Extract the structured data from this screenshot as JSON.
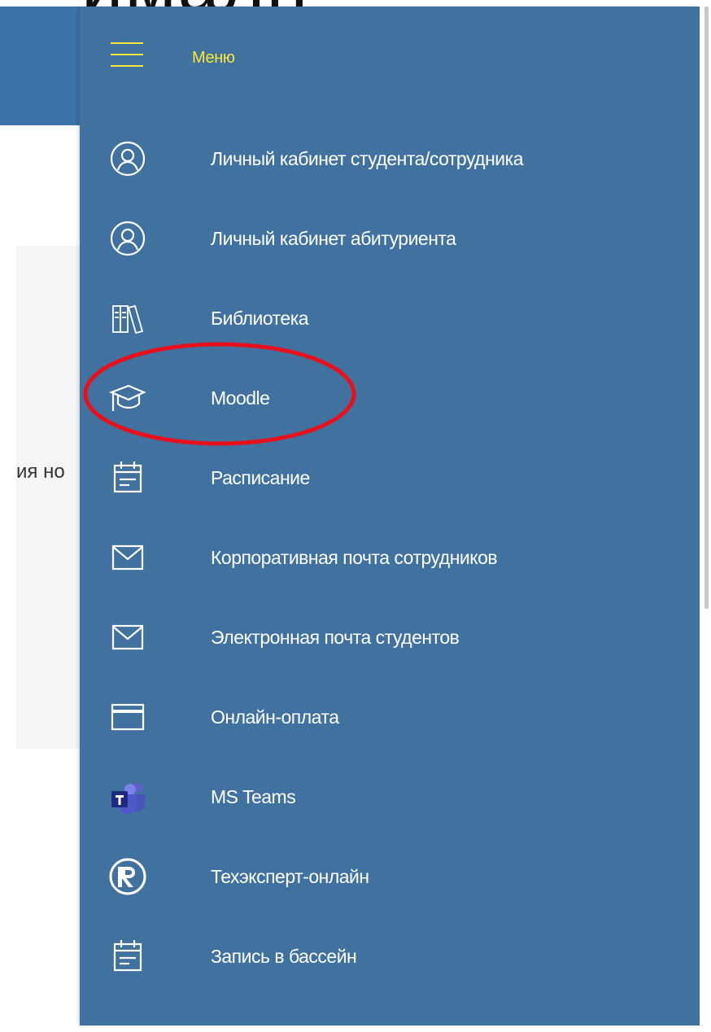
{
  "background": {
    "partial_heading": "ималн",
    "partial_text": "ия но"
  },
  "menu": {
    "title": "Меню",
    "items": [
      {
        "label": "Личный кабинет студента/сотрудника",
        "icon": "user-circle-icon"
      },
      {
        "label": "Личный кабинет абитуриента",
        "icon": "user-circle-icon"
      },
      {
        "label": "Библиотека",
        "icon": "books-icon"
      },
      {
        "label": "Moodle",
        "icon": "graduation-cap-icon"
      },
      {
        "label": "Расписание",
        "icon": "calendar-icon"
      },
      {
        "label": "Корпоративная почта сотрудников",
        "icon": "envelope-icon"
      },
      {
        "label": "Электронная почта студентов",
        "icon": "envelope-icon"
      },
      {
        "label": "Онлайн-оплата",
        "icon": "credit-card-icon"
      },
      {
        "label": "MS Teams",
        "icon": "ms-teams-icon"
      },
      {
        "label": "Техэксперт-онлайн",
        "icon": "registered-icon"
      },
      {
        "label": "Запись в бассейн",
        "icon": "calendar-icon"
      }
    ]
  },
  "colors": {
    "panel": "#41729f",
    "accent": "#f6e63a",
    "highlight": "#e8101c"
  }
}
